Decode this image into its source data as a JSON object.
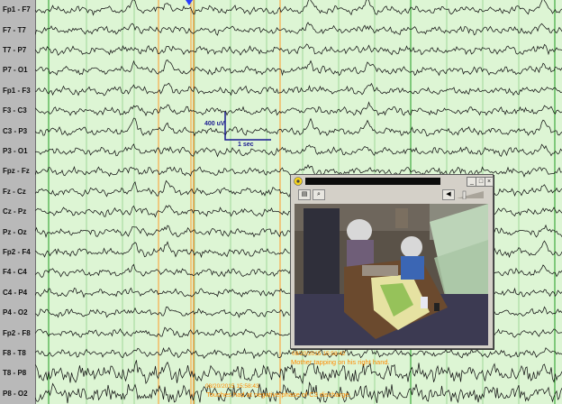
{
  "channels": [
    "Fp1 - F7",
    "F7 - T7",
    "T7 - P7",
    "P7 - O1",
    "Fp1 - F3",
    "F3 - C3",
    "C3 - P3",
    "P3 - O1",
    "Fpz - Fz",
    "Fz - Cz",
    "Cz - Pz",
    "Pz - Oz",
    "Fp2 - F4",
    "F4 - C4",
    "C4 - P4",
    "P4 - O2",
    "Fp2 - F8",
    "F8 - T8",
    "T8 - P8",
    "P8 - O2"
  ],
  "calibration": {
    "amplitude": "400 uV",
    "time": "1 sec"
  },
  "video": {
    "timestamp": "08/20/2015 15:58:42",
    "annotation": "Mother tapping on his right hand."
  },
  "annotations": {
    "bottom_timestamp": "08/20/2015 15:58:43",
    "bottom_text": "Touches had at negative phase of C3 discharge."
  },
  "colors": {
    "background": "#ddf5d4",
    "trace": "#141414",
    "second_gridline": "#1f9c1f",
    "marker": "#ff8a00",
    "montage_panel": "#b9b9b9"
  },
  "icons": {
    "video_toolbar": [
      "film-icon",
      "zoom-icon",
      "speaker-icon"
    ],
    "window_controls": [
      "minimize-icon",
      "restore-icon",
      "close-icon"
    ]
  }
}
